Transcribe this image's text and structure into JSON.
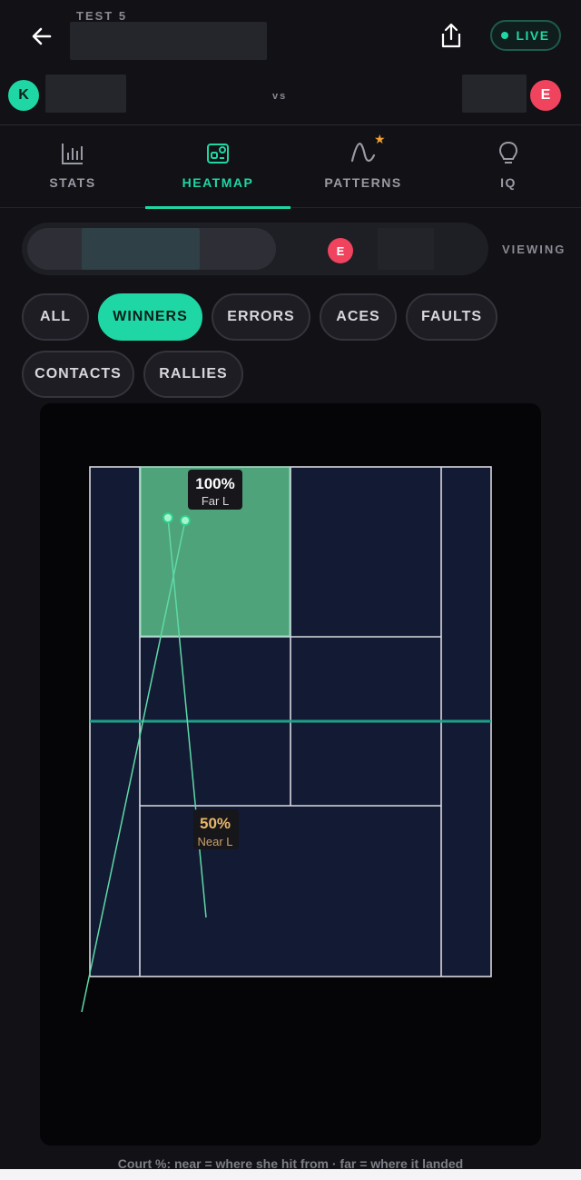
{
  "header": {
    "match_title": "TEST 5",
    "live_label": "LIVE",
    "vs_label": "vs",
    "player_left_initial": "K",
    "player_right_initial": "E"
  },
  "tabs": [
    {
      "label": "STATS",
      "icon": "bar-chart-icon",
      "active": false
    },
    {
      "label": "HEATMAP",
      "icon": "heatmap-icon",
      "active": true
    },
    {
      "label": "PATTERNS",
      "icon": "pattern-curve-icon",
      "active": false,
      "badge": "star"
    },
    {
      "label": "IQ",
      "icon": "lightbulb-icon",
      "active": false
    }
  ],
  "viewer": {
    "right_player_initial": "E",
    "viewing_label": "VIEWING"
  },
  "filters": {
    "all": "ALL",
    "winners": "WINNERS",
    "errors": "ERRORS",
    "aces": "ACES",
    "faults": "FAULTS",
    "contacts": "CONTACTS",
    "rallies": "RALLIES",
    "selected": "WINNERS"
  },
  "heatmap": {
    "far_zone": {
      "percent": "100%",
      "label": "Far L"
    },
    "near_zone": {
      "percent": "50%",
      "label": "Near L"
    }
  },
  "footnote": "Court %: near = where she hit from · far = where it landed",
  "colors": {
    "accent": "#1ed7a5",
    "danger": "#f0435e",
    "court": "#131a33",
    "highlight_zone": "#4fa37a",
    "near_label": "#e8b86a"
  }
}
